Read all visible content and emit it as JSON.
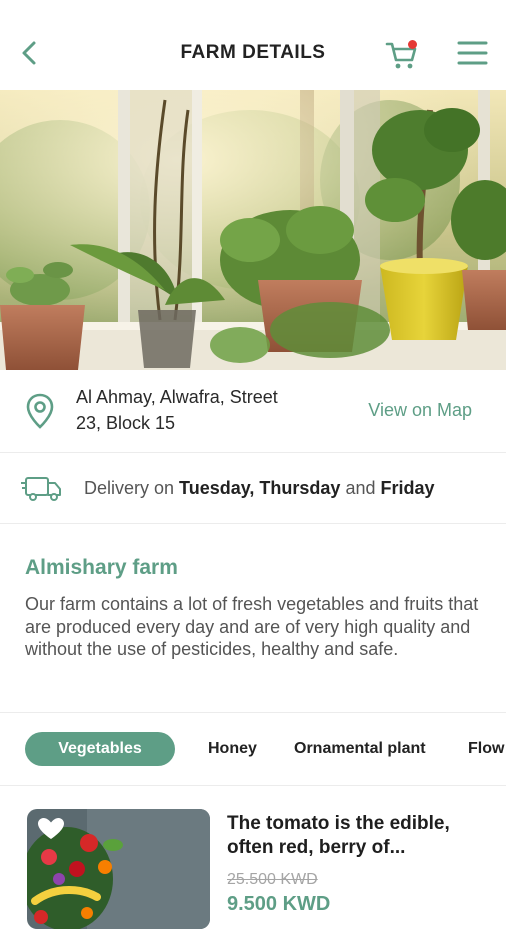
{
  "header": {
    "title": "FARM DETAILS",
    "back_icon": "chevron-left-icon",
    "cart_icon": "cart-icon",
    "menu_icon": "hamburger-menu-icon",
    "cart_badge_color": "#e53935"
  },
  "hero": {
    "alt": "potted plants on a sunny windowsill"
  },
  "address": {
    "icon": "location-pin-icon",
    "line1": "Al Ahmay, Alwafra, Street",
    "line2": "23, Block 15",
    "map_link": "View on Map"
  },
  "delivery": {
    "icon": "delivery-truck-icon",
    "prefix": "Delivery on ",
    "days": "Tuesday, Thursday",
    "and": " and ",
    "last_day": "Friday"
  },
  "farm": {
    "name": "Almishary farm",
    "description": "Our farm contains a lot of fresh vegetables and fruits that are produced every day and are of very high quality and without the use of pesticides, healthy and safe."
  },
  "tabs": [
    {
      "label": "Vegetables",
      "active": true
    },
    {
      "label": "Honey",
      "active": false
    },
    {
      "label": "Ornamental plant",
      "active": false
    },
    {
      "label": "Flow",
      "active": false
    }
  ],
  "products": [
    {
      "title": "The tomato is the edible, often red, berry of...",
      "old_price": "25.500 KWD",
      "new_price": "9.500 KWD",
      "favorite_icon": "heart-icon"
    }
  ],
  "colors": {
    "accent": "#5e9e86",
    "text": "#2b2b2b",
    "muted": "#555555"
  }
}
